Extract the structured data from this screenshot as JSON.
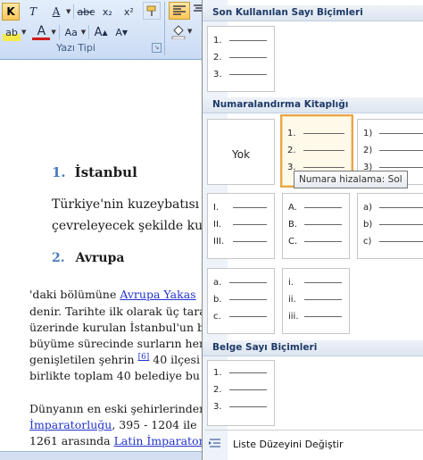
{
  "ribbon": {
    "row1": [
      {
        "name": "bold-button",
        "label": "K"
      },
      {
        "name": "italic-button",
        "label": "T"
      },
      {
        "name": "underline-button",
        "label": "A"
      },
      {
        "name": "strikethrough-button",
        "label": "abc"
      },
      {
        "name": "subscript-button",
        "label": "x₂"
      },
      {
        "name": "superscript-button",
        "label": "x²"
      }
    ],
    "row2": [
      {
        "name": "highlight-button",
        "label": "ab"
      },
      {
        "name": "font-color-button",
        "label": "A"
      },
      {
        "name": "change-case-button",
        "label": "Aa"
      },
      {
        "name": "grow-font-button",
        "label": "A"
      },
      {
        "name": "shrink-font-button",
        "label": "A"
      }
    ],
    "group_label": "Yazı Tipi"
  },
  "document": {
    "h1_num": "1.",
    "h1_text": "İstanbul",
    "para1_line1": "Türkiye'nin kuzeybatısı",
    "para1_line2": "çevreleyecek şekilde ku",
    "h2_num": "2.",
    "h2_text": "Avrupa",
    "body": {
      "l1_pre": "'daki bölümüne ",
      "l1_link": "Avrupa Yakas",
      "l2": "denir. Tarihte ilk olarak üç tara",
      "l3": "üzerinde kurulan İstanbul'un b",
      "l4": "büyüme sürecinde surların her",
      "l5_pre": "genişletilen şehrin ",
      "l5_ref": "[6]",
      "l5_post": " 40 ilçesi",
      "l6": "birlikte toplam 40 belediye bu",
      "l7": "Dünyanın en eski şehirlerinden",
      "l8_link": "İmparatorluğu",
      "l8_post": ", 395 - 1204 ile",
      "l9_pre": "1261 arasında ",
      "l9_link": "Latin İmparator"
    }
  },
  "panel": {
    "recent_header": "Son Kullanılan Sayı Biçimleri",
    "library_header": "Numaralandırma Kitaplığı",
    "document_header": "Belge Sayı Biçimleri",
    "none_label": "Yok",
    "recent_tile": [
      "1.",
      "2.",
      "3."
    ],
    "library_tiles": [
      [
        "1.",
        "2.",
        "3."
      ],
      [
        "1)",
        "2)",
        "3)"
      ],
      [
        "I.",
        "II.",
        "III."
      ],
      [
        "A.",
        "B.",
        "C."
      ],
      [
        "a)",
        "b)",
        "c)"
      ],
      [
        "a.",
        "b.",
        "c."
      ],
      [
        "i.",
        "ii.",
        "iii."
      ]
    ],
    "document_tile": [
      "1.",
      "2.",
      "3."
    ],
    "tooltip": "Numara hizalama: Sol",
    "footer_label": "Liste Düzeyini Değiştir"
  },
  "colors": {
    "accent": "#e8a547",
    "heading_num": "#4a7bbf",
    "link": "#2233cc",
    "section_header_text": "#1e3a68"
  }
}
